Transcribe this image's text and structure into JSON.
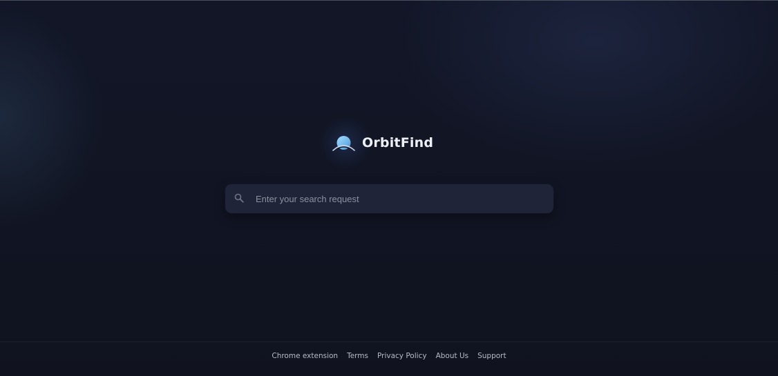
{
  "brand": {
    "name": "OrbitFind",
    "logo_icon": "planet-icon"
  },
  "search": {
    "placeholder": "Enter your search request",
    "value": "",
    "icon": "search-icon"
  },
  "footer": {
    "links": [
      {
        "label": "Chrome extension"
      },
      {
        "label": "Terms"
      },
      {
        "label": "Privacy Policy"
      },
      {
        "label": "About Us"
      },
      {
        "label": "Support"
      }
    ]
  },
  "colors": {
    "background": "#111525",
    "search_bg": "#1f2438",
    "text_primary": "#eef0f6",
    "text_muted": "#8c91a1",
    "logo_accent": "#7cc4f4"
  }
}
